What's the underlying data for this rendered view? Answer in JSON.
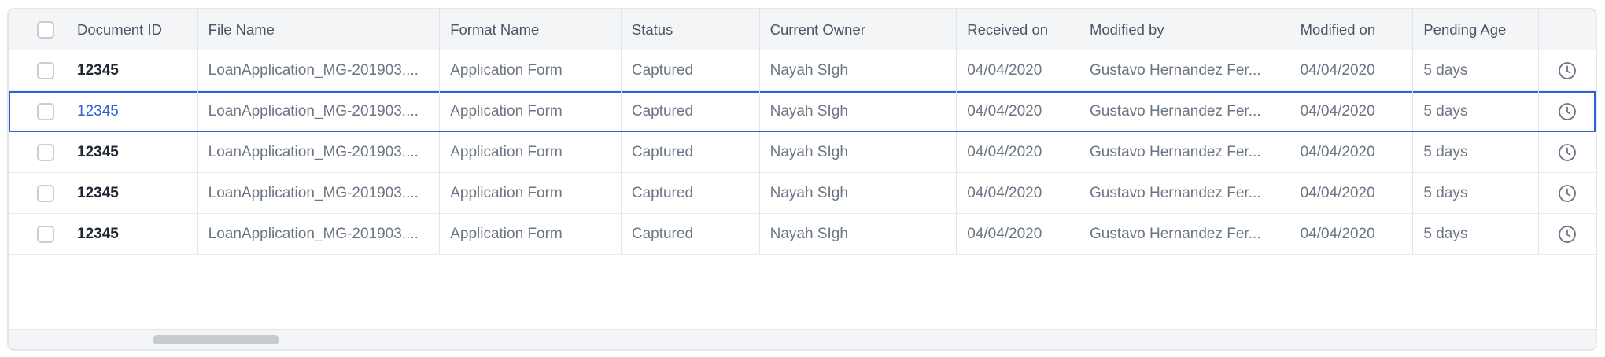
{
  "columns": [
    "Document ID",
    "File Name",
    "Format Name",
    "Status",
    "Current Owner",
    "Received on",
    "Modified by",
    "Modified on",
    "Pending Age"
  ],
  "rows": [
    {
      "doc_id": "12345",
      "file_name": "LoanApplication_MG-201903....",
      "format": "Application Form",
      "status": "Captured",
      "owner": "Nayah SIgh",
      "received": "04/04/2020",
      "modified_by": "Gustavo Hernandez Fer...",
      "modified_on": "04/04/2020",
      "age": "5 days",
      "action_icon": "clock-icon"
    },
    {
      "doc_id": "12345",
      "file_name": "LoanApplication_MG-201903....",
      "format": "Application Form",
      "status": "Captured",
      "owner": "Nayah SIgh",
      "received": "04/04/2020",
      "modified_by": "Gustavo Hernandez Fer...",
      "modified_on": "04/04/2020",
      "age": "5 days",
      "action_icon": "clock-icon"
    },
    {
      "doc_id": "12345",
      "file_name": "LoanApplication_MG-201903....",
      "format": "Application Form",
      "status": "Captured",
      "owner": "Nayah SIgh",
      "received": "04/04/2020",
      "modified_by": "Gustavo Hernandez Fer...",
      "modified_on": "04/04/2020",
      "age": "5 days",
      "action_icon": "clock-icon"
    },
    {
      "doc_id": "12345",
      "file_name": "LoanApplication_MG-201903....",
      "format": "Application Form",
      "status": "Captured",
      "owner": "Nayah SIgh",
      "received": "04/04/2020",
      "modified_by": "Gustavo Hernandez Fer...",
      "modified_on": "04/04/2020",
      "age": "5 days",
      "action_icon": "clock-icon"
    },
    {
      "doc_id": "12345",
      "file_name": "LoanApplication_MG-201903....",
      "format": "Application Form",
      "status": "Captured",
      "owner": "Nayah SIgh",
      "received": "04/04/2020",
      "modified_by": "Gustavo Hernandez Fer...",
      "modified_on": "04/04/2020",
      "age": "5 days",
      "action_icon": "clock-icon"
    }
  ],
  "selected_row": 1,
  "colors": {
    "accent": "#2f62d6",
    "header_bg": "#f4f5f6",
    "border": "#e3e6ea"
  }
}
